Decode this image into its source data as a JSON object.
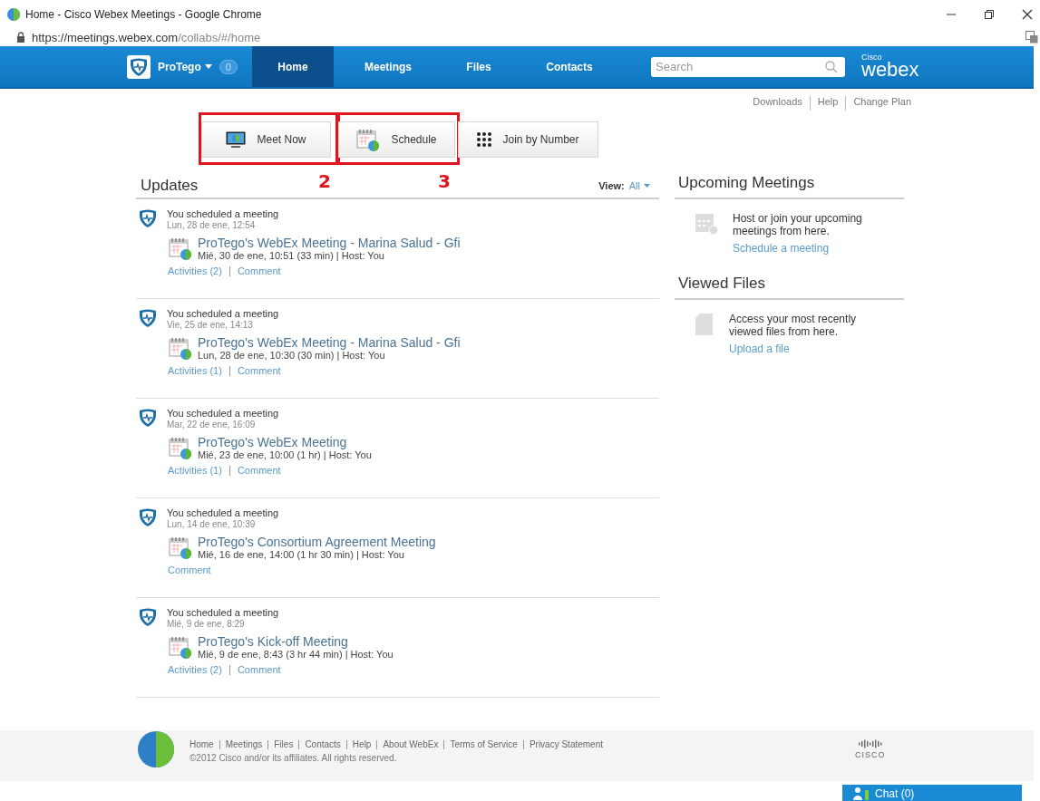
{
  "window": {
    "title": "Home - Cisco Webex Meetings - Google Chrome"
  },
  "address_bar": {
    "host": "https://meetings.webex.com",
    "path": "/collabs/#/home"
  },
  "nav": {
    "user": "ProTego",
    "count": "0",
    "tabs": [
      {
        "label": "Home",
        "selected": true
      },
      {
        "label": "Meetings",
        "selected": false
      },
      {
        "label": "Files",
        "selected": false
      },
      {
        "label": "Contacts",
        "selected": false
      }
    ],
    "search": {
      "placeholder": "Search"
    },
    "logo_small": "Cisco",
    "logo": "webex"
  },
  "top_links": [
    "Downloads",
    "Help",
    "Change Plan"
  ],
  "actions": [
    {
      "label": "Meet Now",
      "kind": "meet",
      "highlighted": true,
      "annotation": "2"
    },
    {
      "label": "Schedule",
      "kind": "schedule",
      "highlighted": true,
      "annotation": "3"
    },
    {
      "label": "Join by Number",
      "kind": "keypad",
      "highlighted": false
    }
  ],
  "updates": {
    "title": "Updates",
    "view_label": "View:",
    "view_value": "All",
    "items": [
      {
        "title": "You scheduled a meeting",
        "date": "Lun, 28 de ene, 12:54",
        "meeting": "ProTego's WebEx Meeting - Marina Salud - Gfi",
        "info": "Mié, 30 de ene, 10:51 (33 min) | Host: You",
        "links": [
          "Activities (2)",
          "Comment"
        ]
      },
      {
        "title": "You scheduled a meeting",
        "date": "Vie, 25 de ene, 14:13",
        "meeting": "ProTego's WebEx Meeting - Marina Salud - Gfi",
        "info": "Lun, 28 de ene, 10:30 (30 min) | Host: You",
        "links": [
          "Activities (1)",
          "Comment"
        ]
      },
      {
        "title": "You scheduled a meeting",
        "date": "Mar, 22 de ene, 16:09",
        "meeting": "ProTego's WebEx Meeting",
        "info": "Mié, 23 de ene, 10:00 (1 hr) | Host: You",
        "links": [
          "Activities (1)",
          "Comment"
        ]
      },
      {
        "title": "You scheduled a meeting",
        "date": "Lun, 14 de ene, 10:39",
        "meeting": "ProTego's Consortium Agreement Meeting",
        "info": "Mié, 16 de ene, 14:00 (1 hr 30 min) | Host: You",
        "links": [
          "Comment"
        ]
      },
      {
        "title": "You scheduled a meeting",
        "date": "Mié, 9 de ene, 8:29",
        "meeting": "ProTego's Kick-off Meeting",
        "info": "Mié, 9 de ene, 8:43 (3 hr 44 min) | Host: You",
        "links": [
          "Activities (2)",
          "Comment"
        ]
      }
    ]
  },
  "side_panels": [
    {
      "title": "Upcoming Meetings",
      "kind": "calendar",
      "text": "Host or join your upcoming meetings from here.",
      "link": "Schedule a meeting"
    },
    {
      "title": "Viewed Files",
      "kind": "file",
      "text": "Access your most recently viewed files from here.",
      "link": "Upload a file"
    }
  ],
  "footer": {
    "links": [
      "Home",
      "Meetings",
      "Files",
      "Contacts",
      "Help",
      "About WebEx",
      "Terms of Service",
      "Privacy Statement"
    ],
    "copyright": "©2012 Cisco and/or its affiliates. All rights reserved.",
    "brand": "CISCO"
  },
  "chat": {
    "label": "Chat (0)"
  }
}
